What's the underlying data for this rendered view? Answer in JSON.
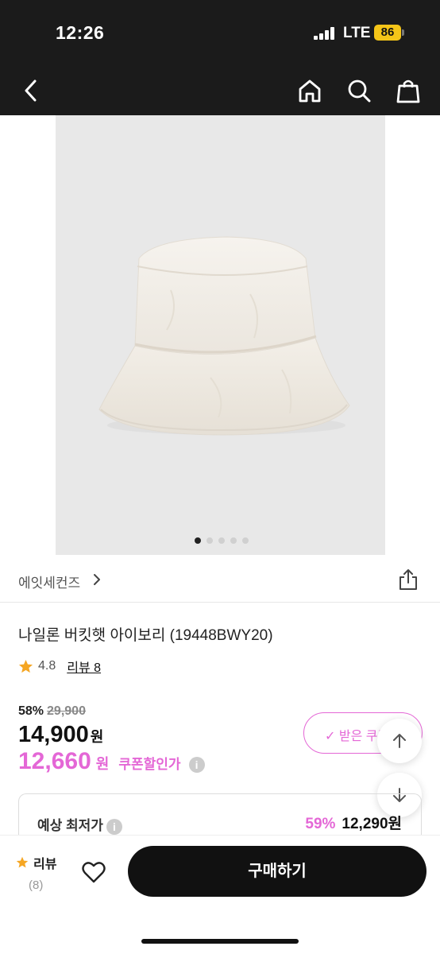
{
  "status_bar": {
    "time": "12:26",
    "network": "LTE",
    "battery": "86"
  },
  "nav": {
    "back_icon": "chevron-left-icon",
    "home_icon": "home-icon",
    "search_icon": "search-icon",
    "bag_icon": "shopping-bag-icon"
  },
  "product_image": {
    "slide_count": 5,
    "active_index": 0
  },
  "brand": {
    "name": "에잇세컨즈"
  },
  "product": {
    "title": "나일론 버킷햇 아이보리 (19448BWY20)"
  },
  "rating": {
    "score": "4.8",
    "review_label": "리뷰 8"
  },
  "pricing": {
    "discount_pct": "58%",
    "original_price": "29,900",
    "sale_price": "14,900",
    "currency": "원",
    "coupon_price": "12,660",
    "coupon_label": "쿠폰할인가",
    "coupon_button_label": "✓ 받은 쿠폰",
    "lowest_label": "예상 최저가",
    "lowest_pct": "59%",
    "lowest_price": "12,290원"
  },
  "bottom_bar": {
    "review_title": "리뷰",
    "review_count": "(8)",
    "buy_label": "구매하기"
  },
  "colors": {
    "accent": "#e467d6",
    "dark": "#111111",
    "star": "#f5a623"
  }
}
